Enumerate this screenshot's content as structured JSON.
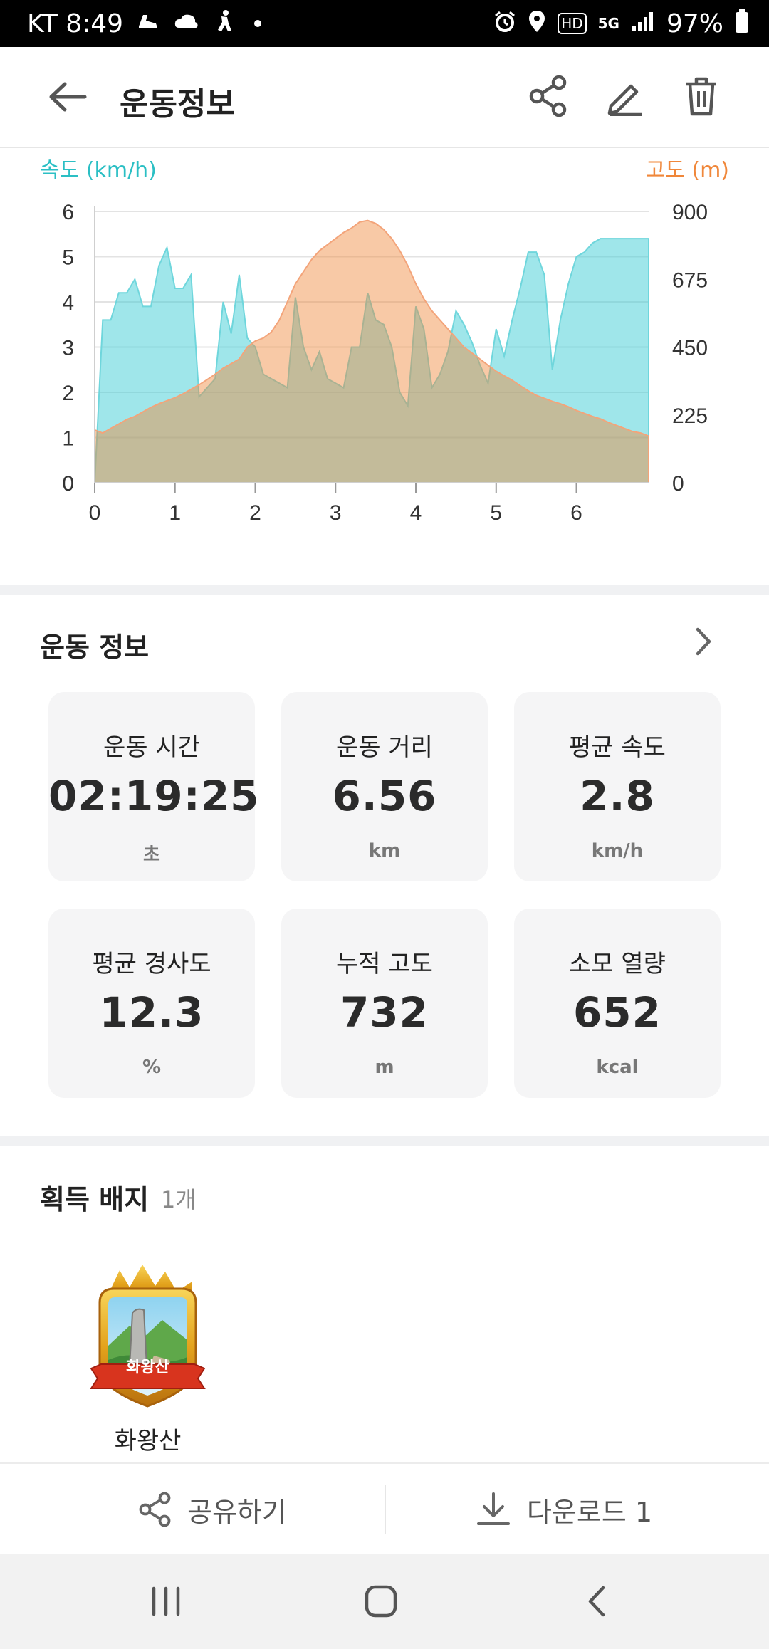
{
  "status_bar": {
    "carrier_time": "KT 8:49",
    "hd_label": "HD",
    "network_label": "5G",
    "battery": "97%"
  },
  "header": {
    "title": "운동정보",
    "icons": [
      "back-arrow-icon",
      "share-icon",
      "edit-icon",
      "trash-icon"
    ]
  },
  "chart_data": {
    "type": "area",
    "left_axis_label": "속도 (km/h)",
    "right_axis_label": "고도 (m)",
    "x_ticks": [
      "0",
      "1",
      "2",
      "3",
      "4",
      "5",
      "6"
    ],
    "y_left_ticks": [
      "0",
      "1",
      "2",
      "3",
      "4",
      "5",
      "6"
    ],
    "y_right_ticks": [
      "0",
      "225",
      "450",
      "675",
      "900"
    ],
    "xlim": [
      0,
      6.9
    ],
    "ylim_left": [
      0,
      6
    ],
    "ylim_right": [
      0,
      900
    ],
    "grid": true,
    "colors": {
      "speed": "#2bbfc4",
      "altitude": "#f0873a"
    },
    "series": [
      {
        "axis": "left",
        "x": [
          0,
          0.1,
          0.2,
          0.3,
          0.4,
          0.5,
          0.6,
          0.7,
          0.8,
          0.9,
          1.0,
          1.1,
          1.2,
          1.3,
          1.4,
          1.5,
          1.6,
          1.7,
          1.8,
          1.9,
          2.0,
          2.1,
          2.2,
          2.3,
          2.4,
          2.5,
          2.6,
          2.7,
          2.8,
          2.9,
          3.0,
          3.1,
          3.2,
          3.3,
          3.4,
          3.5,
          3.6,
          3.7,
          3.8,
          3.9,
          4.0,
          4.1,
          4.2,
          4.3,
          4.4,
          4.5,
          4.6,
          4.7,
          4.8,
          4.9,
          5.0,
          5.1,
          5.2,
          5.3,
          5.4,
          5.5,
          5.6,
          5.7,
          5.8,
          5.9,
          6.0,
          6.1,
          6.2,
          6.3,
          6.4,
          6.5,
          6.6,
          6.7,
          6.8,
          6.9
        ],
        "values": [
          0,
          3.6,
          3.6,
          4.2,
          4.2,
          4.5,
          3.9,
          3.9,
          4.8,
          5.2,
          4.3,
          4.3,
          4.6,
          1.9,
          2.1,
          2.3,
          4.0,
          3.3,
          4.6,
          3.2,
          3.0,
          2.4,
          2.3,
          2.2,
          2.1,
          4.1,
          3.0,
          2.5,
          2.9,
          2.3,
          2.2,
          2.1,
          3.0,
          3.0,
          4.2,
          3.6,
          3.5,
          3.0,
          2.0,
          1.7,
          3.9,
          3.4,
          2.1,
          2.4,
          2.9,
          3.8,
          3.5,
          3.1,
          2.6,
          2.2,
          3.4,
          2.8,
          3.6,
          4.3,
          5.1,
          5.1,
          4.6,
          2.5,
          3.6,
          4.4,
          5.0,
          5.1,
          5.3,
          5.4,
          5.4,
          5.4,
          5.4,
          5.4,
          5.4,
          5.4
        ]
      },
      {
        "axis": "right",
        "x": [
          0,
          0.1,
          0.2,
          0.3,
          0.4,
          0.5,
          0.6,
          0.7,
          0.8,
          0.9,
          1.0,
          1.1,
          1.2,
          1.3,
          1.4,
          1.5,
          1.6,
          1.7,
          1.8,
          1.9,
          2.0,
          2.1,
          2.2,
          2.3,
          2.4,
          2.5,
          2.6,
          2.7,
          2.8,
          2.9,
          3.0,
          3.1,
          3.2,
          3.3,
          3.4,
          3.5,
          3.6,
          3.7,
          3.8,
          3.9,
          4.0,
          4.1,
          4.2,
          4.3,
          4.4,
          4.5,
          4.6,
          4.7,
          4.8,
          4.9,
          5.0,
          5.1,
          5.2,
          5.3,
          5.4,
          5.5,
          5.6,
          5.7,
          5.8,
          5.9,
          6.0,
          6.1,
          6.2,
          6.3,
          6.4,
          6.5,
          6.6,
          6.7,
          6.8,
          6.9
        ],
        "values": [
          175,
          165,
          180,
          195,
          210,
          220,
          235,
          250,
          262,
          272,
          282,
          295,
          310,
          325,
          342,
          360,
          380,
          395,
          410,
          450,
          470,
          480,
          500,
          540,
          600,
          660,
          700,
          740,
          770,
          790,
          810,
          830,
          845,
          865,
          870,
          860,
          840,
          810,
          770,
          720,
          660,
          610,
          570,
          540,
          510,
          480,
          450,
          430,
          410,
          390,
          370,
          355,
          340,
          322,
          305,
          290,
          280,
          270,
          262,
          252,
          240,
          230,
          220,
          212,
          200,
          190,
          180,
          170,
          165,
          155
        ]
      }
    ]
  },
  "stats": {
    "title": "운동 정보",
    "cards": [
      {
        "label": "운동 시간",
        "value": "02:19:25",
        "unit": "초"
      },
      {
        "label": "운동 거리",
        "value": "6.56",
        "unit": "km"
      },
      {
        "label": "평균 속도",
        "value": "2.8",
        "unit": "km/h"
      },
      {
        "label": "평균 경사도",
        "value": "12.3",
        "unit": "%"
      },
      {
        "label": "누적 고도",
        "value": "732",
        "unit": "m"
      },
      {
        "label": "소모 열량",
        "value": "652",
        "unit": "kcal"
      }
    ]
  },
  "badges": {
    "title": "획득 배지",
    "count": "1개",
    "items": [
      {
        "name": "화왕산",
        "ribbon_text": "화왕산"
      }
    ]
  },
  "actions": {
    "share_label": "공유하기",
    "download_label": "다운로드 1"
  }
}
